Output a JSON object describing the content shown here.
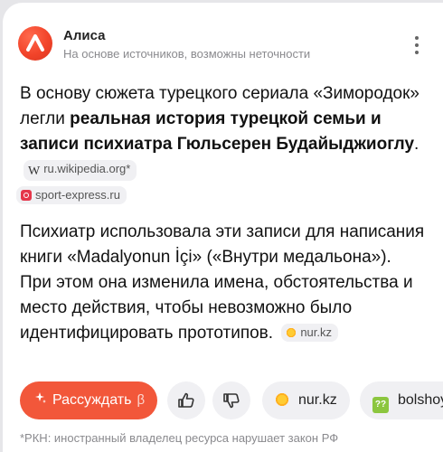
{
  "header": {
    "brand": "Алиса",
    "subtitle": "На основе источников, возможны неточности",
    "menu_icon": "more-vertical-icon"
  },
  "answer": {
    "p1_text_1": "В основу сюжета турецкого сериала «Зимородок» легли ",
    "p1_bold": "реальная история турецкой семьи и записи психиатра Гюльсерен Будайыджиоглу",
    "p1_text_2": ".",
    "p1_sources": [
      {
        "icon": "wikipedia-icon",
        "glyph": "W",
        "label": "ru.wikipedia.org*"
      },
      {
        "icon": "sport-express-icon",
        "label": "sport-express.ru"
      }
    ],
    "p2_text": "Психиатр использовала эти записи для написания книги «Madalyonun İçi» («Внутри медальона»). При этом она изменила имена, обстоятельства и место действия, чтобы невозможно было идентифицировать прототипов.",
    "p2_source": {
      "icon": "nur-icon",
      "label": "nur.kz"
    }
  },
  "actions": {
    "reason_label": "Рассуждать",
    "reason_beta": "β",
    "like_icon": "thumbs-up-icon",
    "dislike_icon": "thumbs-down-icon",
    "sources": [
      {
        "icon": "nur-icon",
        "label": "nur.kz"
      },
      {
        "icon": "bolshoy-icon",
        "glyph": "??",
        "label": "bolshoy"
      }
    ]
  },
  "footnote": "*РКН: иностранный владелец ресурса нарушает закон РФ",
  "colors": {
    "accent": "#f2573a",
    "brand": "#f2442a",
    "muted": "#8a8a8e",
    "chip_bg": "#f0f0f3"
  }
}
